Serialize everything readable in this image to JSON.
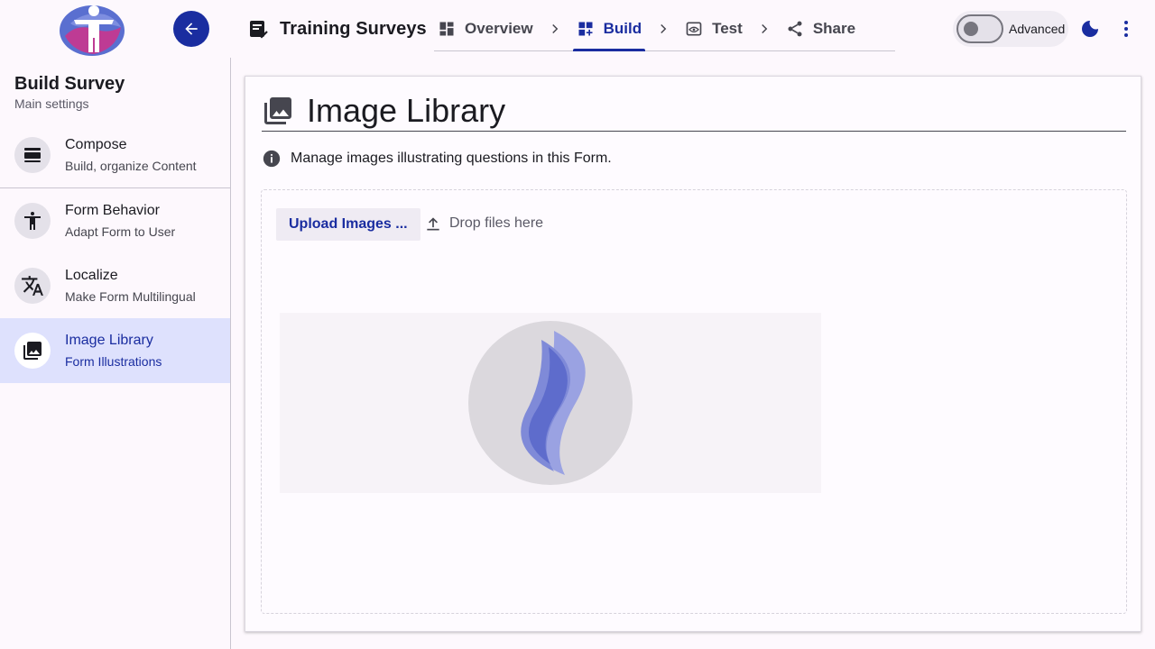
{
  "header": {
    "title": "Training Surveys",
    "steps": [
      {
        "label": "Overview",
        "active": false
      },
      {
        "label": "Build",
        "active": true
      },
      {
        "label": "Test",
        "active": false
      },
      {
        "label": "Share",
        "active": false
      }
    ],
    "advanced_label": "Advanced",
    "advanced_on": false
  },
  "sidebar": {
    "title": "Build Survey",
    "subtitle": "Main settings",
    "items": [
      {
        "label": "Compose",
        "sub": "Build, organize Content",
        "icon": "compose-icon"
      },
      {
        "label": "Form Behavior",
        "sub": "Adapt Form to User",
        "icon": "accessibility-icon"
      },
      {
        "label": "Localize",
        "sub": "Make Form Multilingual",
        "icon": "translate-icon"
      },
      {
        "label": "Image Library",
        "sub": "Form Illustrations",
        "icon": "photo-library-icon",
        "active": true
      }
    ]
  },
  "main": {
    "title": "Image Library",
    "info": "Manage images illustrating questions in this Form.",
    "upload_label": "Upload Images ...",
    "drop_hint": "Drop files here"
  },
  "colors": {
    "accent": "#1a2da0",
    "active_bg": "#dee1fd",
    "background": "#fdf8fd"
  }
}
